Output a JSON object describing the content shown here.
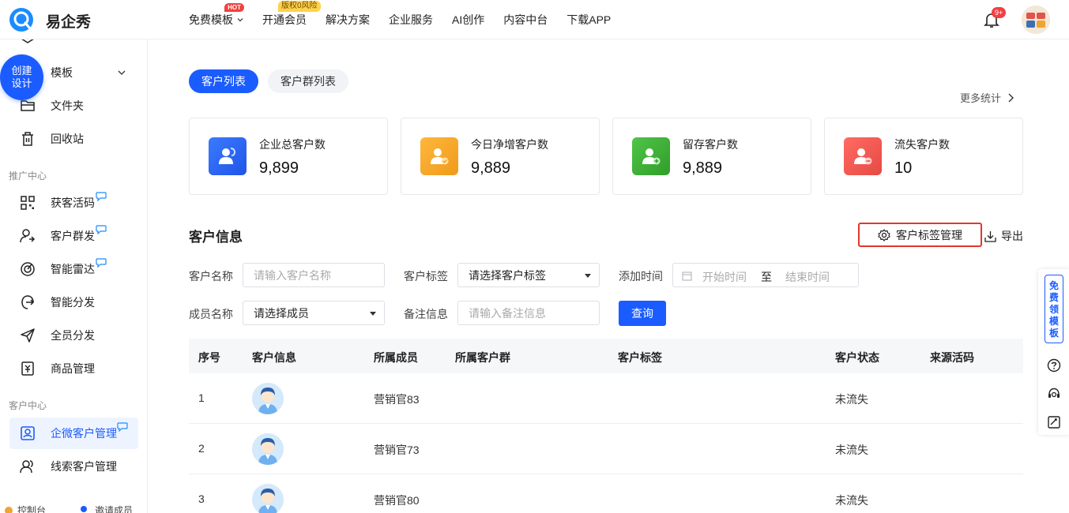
{
  "header": {
    "brand": "易企秀",
    "nav": [
      {
        "label": "免费模板",
        "badge": "HOT",
        "has_chevron": true
      },
      {
        "label": "开通会员",
        "badge": "版权0风险"
      },
      {
        "label": "解决方案"
      },
      {
        "label": "企业服务"
      },
      {
        "label": "AI创作"
      },
      {
        "label": "内容中台"
      },
      {
        "label": "下载APP"
      }
    ],
    "notification_count": "9+"
  },
  "sidebar": {
    "create_button": "创建设计",
    "create_line1": "创建",
    "create_line2": "设计",
    "items_top": [
      {
        "label": "模板",
        "icon": "cube-icon",
        "has_chevron": true
      },
      {
        "label": "文件夹",
        "icon": "folder-icon"
      },
      {
        "label": "回收站",
        "icon": "trash-icon"
      }
    ],
    "section_promo": "推广中心",
    "items_promo": [
      {
        "label": "获客活码",
        "icon": "qrcode-icon",
        "new": true
      },
      {
        "label": "客户群发",
        "icon": "user-broadcast-icon",
        "new": true
      },
      {
        "label": "智能雷达",
        "icon": "radar-icon",
        "new": true
      },
      {
        "label": "智能分发",
        "icon": "distribute-icon"
      },
      {
        "label": "全员分发",
        "icon": "send-icon"
      },
      {
        "label": "商品管理",
        "icon": "goods-icon"
      }
    ],
    "section_customer": "客户中心",
    "items_customer": [
      {
        "label": "企微客户管理",
        "icon": "contact-card-icon",
        "active": true,
        "new": true
      },
      {
        "label": "线索客户管理",
        "icon": "users-icon"
      }
    ],
    "bottom": {
      "console": "控制台",
      "invite": "邀请成员"
    }
  },
  "main": {
    "tabs": [
      {
        "label": "客户列表",
        "active": true
      },
      {
        "label": "客户群列表",
        "active": false
      }
    ],
    "more_stats": "更多统计",
    "stats": [
      {
        "label": "企业总客户数",
        "value": "9,899",
        "color": "#2f6bf5"
      },
      {
        "label": "今日净增客户数",
        "value": "9,889",
        "color": "#f0a530"
      },
      {
        "label": "留存客户数",
        "value": "9,889",
        "color": "#3fb43a"
      },
      {
        "label": "流失客户数",
        "value": "10",
        "color": "#ef5350"
      }
    ],
    "section_title": "客户信息",
    "tag_manage": "客户标签管理",
    "export": "导出",
    "filters": {
      "customer_name_label": "客户名称",
      "customer_name_placeholder": "请输入客户名称",
      "customer_tag_label": "客户标签",
      "customer_tag_value": "请选择客户标签",
      "add_time_label": "添加时间",
      "start_placeholder": "开始时间",
      "to": "至",
      "end_placeholder": "结束时间",
      "member_label": "成员名称",
      "member_value": "请选择成员",
      "remark_label": "备注信息",
      "remark_placeholder": "请输入备注信息",
      "query": "查询"
    },
    "table": {
      "columns": [
        "序号",
        "客户信息",
        "所属成员",
        "所属客户群",
        "客户标签",
        "客户状态",
        "来源活码"
      ],
      "rows": [
        {
          "index": "1",
          "member": "营销官83",
          "group": "",
          "tag": "",
          "status": "未流失",
          "source": ""
        },
        {
          "index": "2",
          "member": "营销官73",
          "group": "",
          "tag": "",
          "status": "未流失",
          "source": ""
        },
        {
          "index": "3",
          "member": "营销官80",
          "group": "",
          "tag": "",
          "status": "未流失",
          "source": ""
        }
      ]
    }
  },
  "float_bar": {
    "free_template": "免费领模板",
    "free_chars": [
      "免",
      "费",
      "领",
      "模",
      "板"
    ]
  },
  "colors": {
    "primary": "#1a5cff",
    "highlight_border": "#e0392b"
  }
}
